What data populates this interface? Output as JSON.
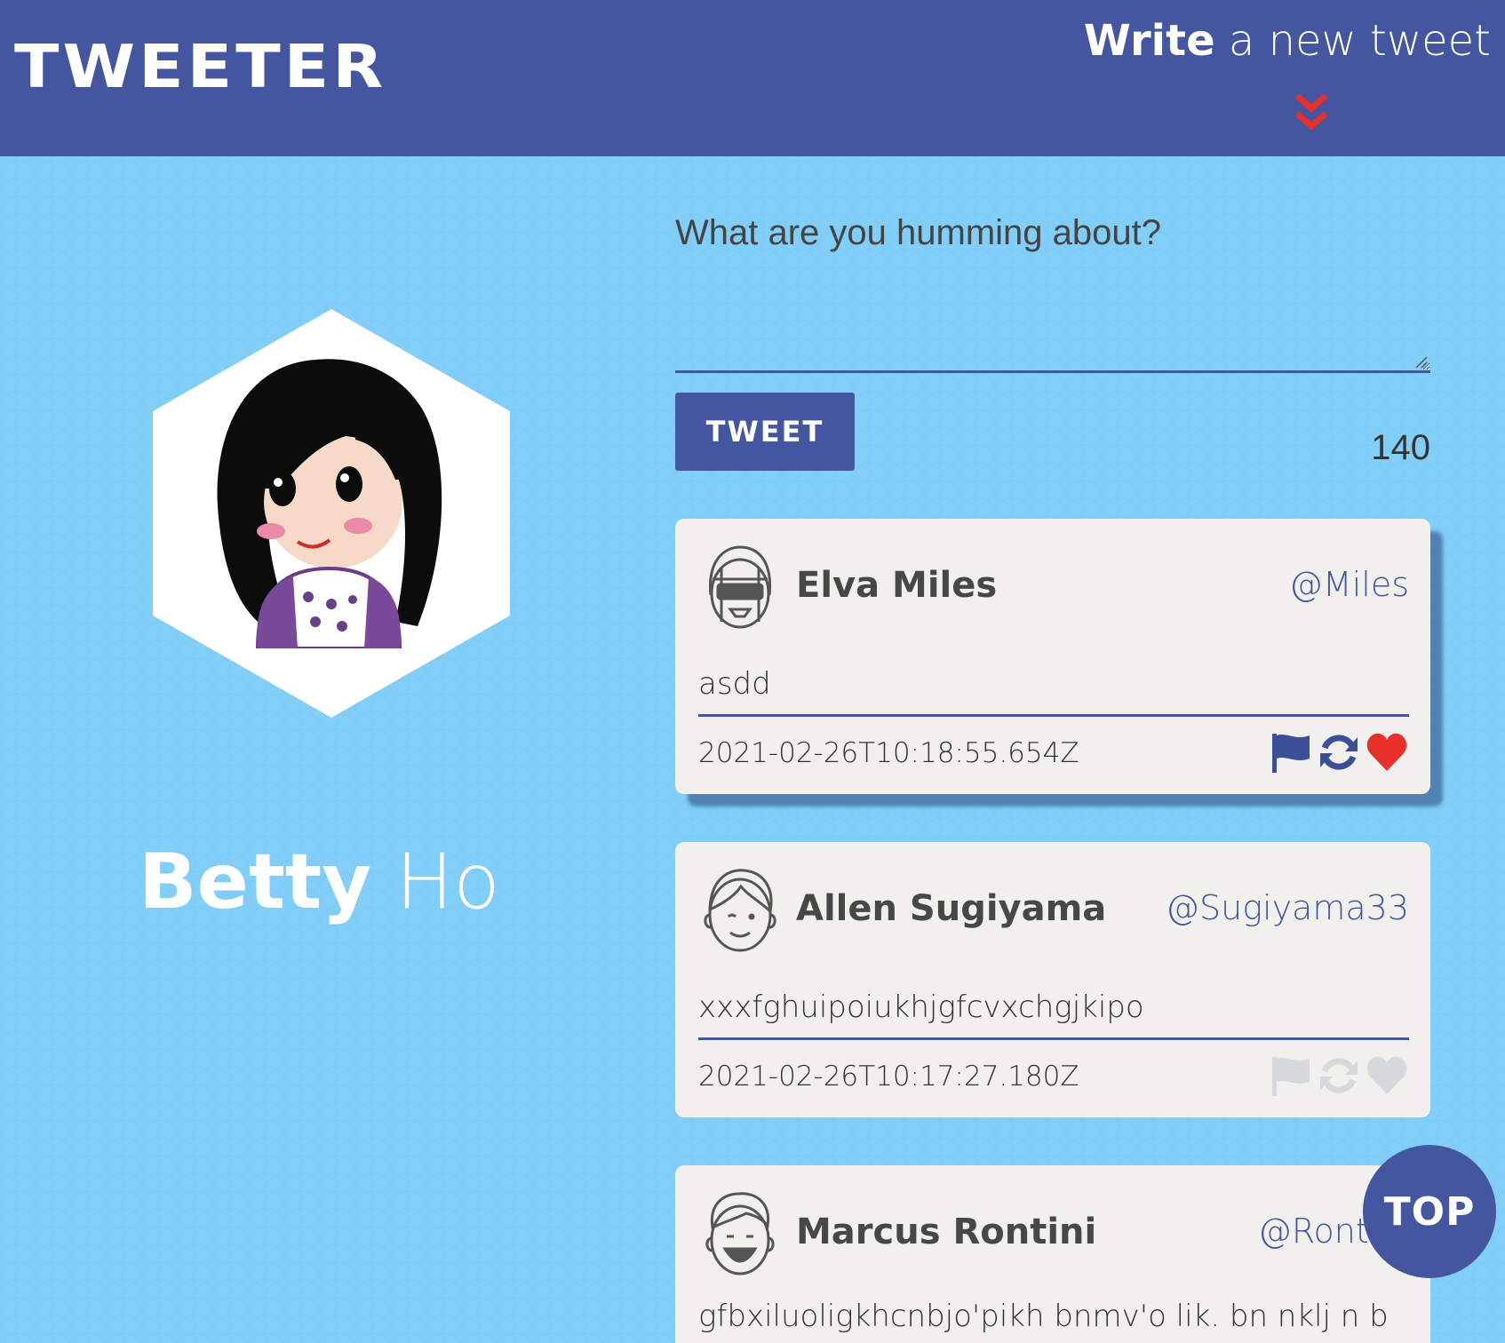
{
  "header": {
    "brand": "TWEETER",
    "write_bold": "Write",
    "write_rest": " a new tweet"
  },
  "profile": {
    "first_name": "Betty",
    "last_name": "Ho"
  },
  "compose": {
    "label": "What are you humming about?",
    "text": "",
    "button_label": "TWEET",
    "counter": "140"
  },
  "tweets": [
    {
      "name": "Elva Miles",
      "handle": "@Miles",
      "text": "asdd",
      "timestamp": "2021-02-26T10:18:55.654Z",
      "actions_active": true
    },
    {
      "name": "Allen Sugiyama",
      "handle": "@Sugiyama33",
      "text": "xxxfghuipoiukhjgfcvxchgjkipo",
      "timestamp": "2021-02-26T10:17:27.180Z",
      "actions_active": false
    },
    {
      "name": "Marcus Rontini",
      "handle": "@Rontini",
      "text": "gfbxiluoligkhcnbjo'pikh bnmv'o lik. bn nklj n b"
    }
  ],
  "top_button": "TOP",
  "colors": {
    "nav": "#4456a0",
    "background": "#81cef8",
    "card": "#f1f0ec",
    "accent_red": "#e8302a",
    "inactive_icon": "#d6d8dc"
  },
  "icons": {
    "flag": "flag-icon",
    "retweet": "retweet-icon",
    "like": "heart-icon",
    "chevron": "double-chevron-down-icon"
  }
}
